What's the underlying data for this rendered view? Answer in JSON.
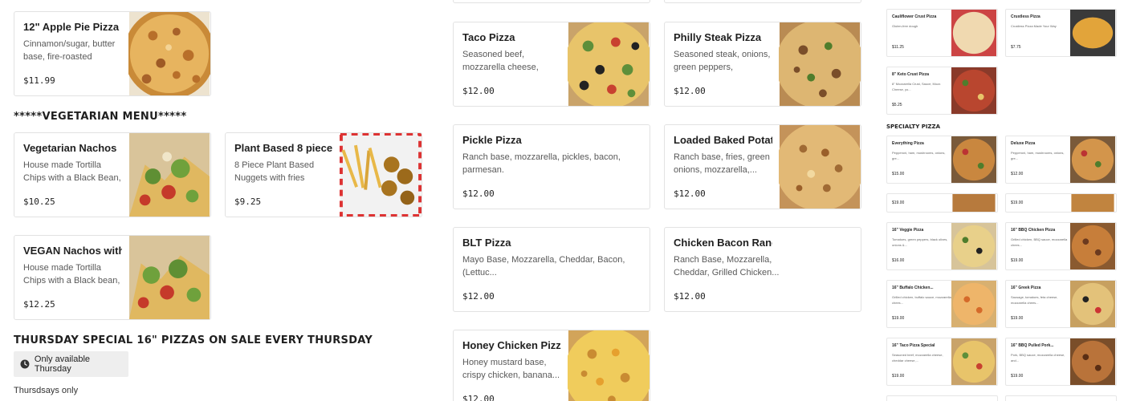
{
  "left_column": {
    "top_items": [
      {
        "name": "12\" Apple Pie Pizza",
        "desc": "Cinnamon/sugar, butter base, fire-roasted apples...",
        "price": "$11.99",
        "image": "apple-pie-pizza-photo"
      }
    ],
    "vegetarian_title": "*****VEGETARIAN MENU*****",
    "vegetarian_items": [
      {
        "name": "Vegetarian Nachos",
        "desc": "House made Tortilla Chips with a Black Bean, Brow...",
        "price": "$10.25",
        "image": "vegetarian-nachos-photo"
      },
      {
        "name": "Plant Based 8 piece...",
        "desc": "8 Piece Plant Based Nuggets with fries",
        "price": "$9.25",
        "image": "plant-based-nuggets-photo"
      },
      {
        "name": "VEGAN Nachos with...",
        "desc": "House made Tortilla Chips with a Black bean, Brow...",
        "price": "$12.25",
        "image": "vegan-nachos-photo"
      }
    ],
    "thursday_title": "THURSDAY SPECIAL 16\" PIZZAS ON SALE EVERY THURSDAY",
    "availability_label": "Only available Thursday",
    "availability_icon": "clock-icon",
    "thursday_note": "Thursdsays only"
  },
  "middle_column": {
    "items": [
      {
        "name": "Taco Pizza",
        "desc": "Seasoned beef, mozzarella cheese, cheddar cheese,...",
        "price": "$12.00",
        "image": "taco-pizza-photo"
      },
      {
        "name": "Philly Steak Pizza",
        "desc": "Seasoned steak, onions, green peppers, mozzarell...",
        "price": "$12.00",
        "image": "philly-steak-pizza-photo"
      },
      {
        "name": "Pickle Pizza",
        "desc": "Ranch base, mozzarella, pickles, bacon, parmesan.",
        "price": "$12.00",
        "image": "none"
      },
      {
        "name": "Loaded Baked Potato",
        "desc": "Ranch base, fries, green onions, mozzarella,...",
        "price": "$12.00",
        "image": "loaded-potato-pizza-photo"
      },
      {
        "name": "BLT Pizza",
        "desc": "Mayo Base, Mozzarella, Cheddar, Bacon, (Lettuc...",
        "price": "$12.00",
        "image": "none"
      },
      {
        "name": "Chicken Bacon Ranc...",
        "desc": "Ranch Base, Mozzarella, Cheddar, Grilled Chicken...",
        "price": "$12.00",
        "image": "none"
      },
      {
        "name": "Honey Chicken Pizza",
        "desc": "Honey mustard base, crispy chicken, banana...",
        "price": "$12.00",
        "image": "honey-chicken-pizza-photo"
      }
    ]
  },
  "right_column": {
    "items_top": [
      {
        "name": "Cauliflower Crust Pizza",
        "desc": "Gluten-free dough",
        "price": "$11.25"
      },
      {
        "name": "Crustless Pizza",
        "desc": "Crustless Pizza Made Your Way",
        "price": "$7.75"
      },
      {
        "name": "8\" Keto Crust Pizza",
        "desc": "8\" Mozzarella Crust, Sauce, Mozz. Cheese, yo...",
        "price": "$5.25"
      }
    ],
    "specialty_title": "SPECIALTY PIZZA",
    "specialty_items": [
      {
        "name": "Everything Pizza",
        "desc": "Pepperoni, ham, mushrooms, onions, gre...",
        "price": "$15.00"
      },
      {
        "name": "Deluxe Pizza",
        "desc": "Pepperoni, ham, mushrooms, onions, gre...",
        "price": "$12.00"
      },
      {
        "name": "",
        "desc": "",
        "price": "$19.00"
      },
      {
        "name": "",
        "desc": "",
        "price": "$19.00"
      },
      {
        "name": "16\" Veggie Pizza",
        "desc": "Tomatoes, green peppers, black olives, onions &...",
        "price": "$16.00"
      },
      {
        "name": "16\" BBQ Chicken Pizza",
        "desc": "Grilled chicken, BBQ sauce, mozzarella chees...",
        "price": "$19.00"
      },
      {
        "name": "16\" Buffalo Chicken...",
        "desc": "Grilled chicken, buffalo sauce, mozzarella chees...",
        "price": "$19.00"
      },
      {
        "name": "16\" Greek Pizza",
        "desc": "Sausage, tomatoes, feta cheese, mozzarella chees...",
        "price": "$19.00"
      },
      {
        "name": "16\" Taco Pizza Special",
        "desc": "Seasoned beef, mozzarella cheese, cheddar cheese,...",
        "price": "$19.00"
      },
      {
        "name": "16\" BBQ Pulled Pork...",
        "desc": "Pork, BBQ sauce, mozzarella cheese, and...",
        "price": "$19.00"
      }
    ]
  },
  "colors": {
    "card_border": "#e2e2e2",
    "pill_bg": "#eeeeee",
    "text_primary": "#1f1f1f",
    "text_secondary": "#595959"
  }
}
